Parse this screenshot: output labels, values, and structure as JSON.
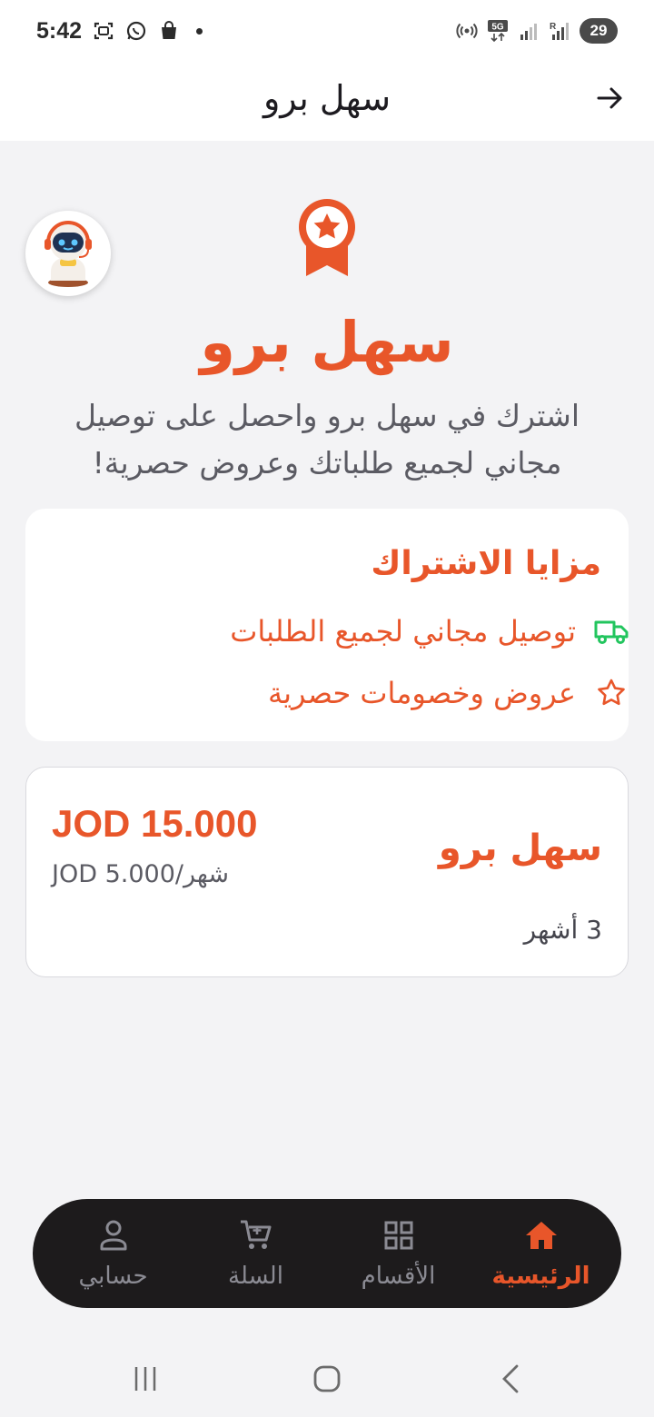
{
  "status_bar": {
    "time": "5:42",
    "network": "5G",
    "roaming": "R",
    "battery": "29"
  },
  "header": {
    "title": "سهل برو"
  },
  "hero": {
    "title": "سهل برو",
    "description": "اشترك في سهل برو واحصل على توصيل مجاني لجميع طلباتك وعروض حصرية!"
  },
  "features": {
    "title": "مزايا الاشتراك",
    "items": [
      {
        "label": "توصيل مجاني لجميع الطلبات",
        "icon": "truck-icon",
        "icon_color": "#22c55e"
      },
      {
        "label": "عروض وخصومات حصرية",
        "icon": "star-icon",
        "icon_color": "#e8562a"
      }
    ]
  },
  "plan": {
    "name": "سهل برو",
    "duration": "3 أشهر",
    "price": "JOD 15.000",
    "monthly": "JOD 5.000/شهر"
  },
  "bottom_nav": {
    "items": [
      {
        "label": "الرئيسية",
        "icon": "home-icon",
        "active": true
      },
      {
        "label": "الأقسام",
        "icon": "grid-icon",
        "active": false
      },
      {
        "label": "السلة",
        "icon": "cart-icon",
        "active": false
      },
      {
        "label": "حسابي",
        "icon": "user-icon",
        "active": false
      }
    ]
  },
  "colors": {
    "accent": "#e8562a",
    "nav_background": "#1d1b1c",
    "page_background": "#f3f3f5"
  }
}
